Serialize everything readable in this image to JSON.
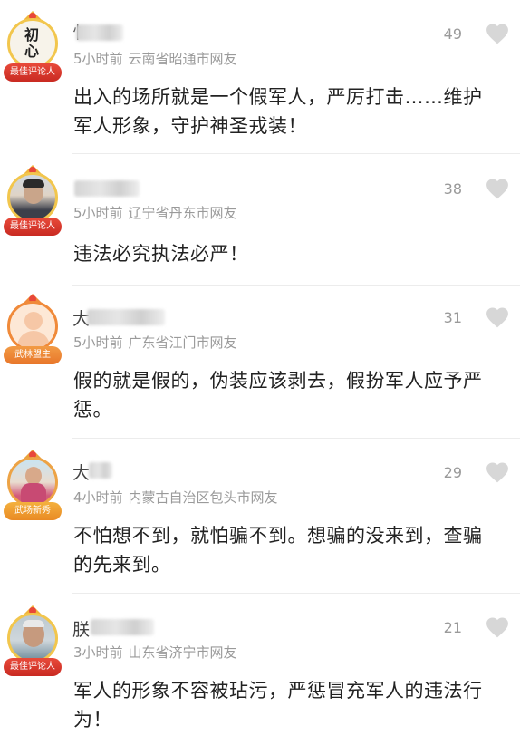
{
  "comments": [
    {
      "name_glyph": "忄",
      "avatar_text": "初心",
      "badge": "最佳评论人",
      "time": "5小时前",
      "location": "云南省昭通市网友",
      "likes": "49",
      "text": "出入的场所就是一个假军人，严厉打击……维护军人形象，守护神圣戎装！"
    },
    {
      "name_glyph": "",
      "badge": "最佳评论人",
      "time": "5小时前",
      "location": "辽宁省丹东市网友",
      "likes": "38",
      "text": "违法必究执法必严！"
    },
    {
      "name_glyph": "大",
      "badge": "武林盟主",
      "time": "5小时前",
      "location": "广东省江门市网友",
      "likes": "31",
      "text": "假的就是假的，伪装应该剥去，假扮军人应予严惩。"
    },
    {
      "name_glyph": "大",
      "badge": "武场新秀",
      "time": "4小时前",
      "location": "内蒙古自治区包头市网友",
      "likes": "29",
      "text": "不怕想不到，就怕骗不到。想骗的没来到，查骗的先来到。"
    },
    {
      "name_glyph": "朕",
      "badge": "最佳评论人",
      "time": "3小时前",
      "location": "山东省济宁市网友",
      "likes": "21",
      "text": "军人的形象不容被玷污，严惩冒充军人的违法行为！"
    }
  ],
  "icons": {
    "like": "heart-icon"
  },
  "colors": {
    "badge_red": "#d8352a",
    "badge_orange": "#ee8a35",
    "meta_gray": "#9a9a9a"
  }
}
